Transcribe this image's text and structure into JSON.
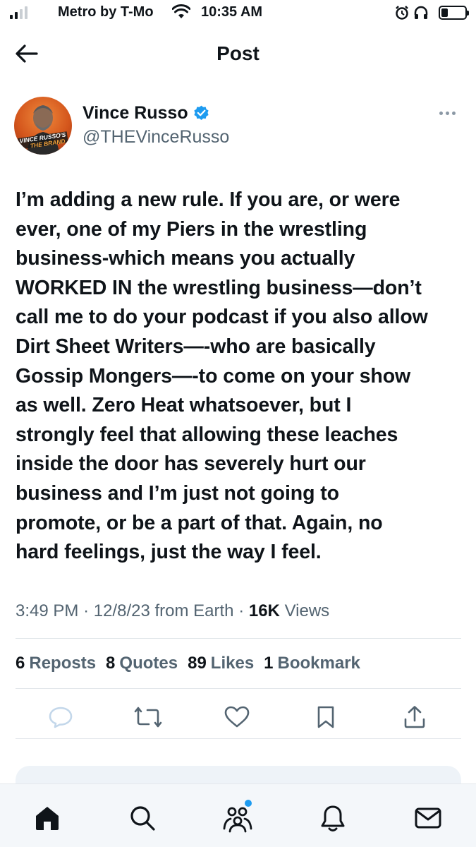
{
  "status_bar": {
    "carrier": "Metro by T-Mo",
    "time": "10:35 AM",
    "battery_level": 0.28,
    "signal_bars": 2,
    "icons": [
      "signal-icon",
      "wifi-icon",
      "alarm-icon",
      "headphones-icon",
      "battery-icon"
    ]
  },
  "header": {
    "title": "Post",
    "back_icon": "arrow-left-icon"
  },
  "author": {
    "name": "Vince Russo",
    "handle": "@THEVinceRusso",
    "verified": true,
    "avatar_caption": "VINCE RUSSO'S THE BRAND",
    "accent_color": "#1d9bf0"
  },
  "tweet": {
    "lines": [
      "I’m adding a new rule. If you are, or were",
      "ever, one of my Piers in the wrestling",
      "business-which means you actually",
      "WORKED IN the wrestling business—don’t",
      "call me to do your podcast if you also allow",
      "Dirt Sheet Writers—-who are basically",
      "Gossip Mongers—-to come on your show",
      "as well. Zero Heat whatsoever, but I",
      "strongly feel that allowing these  leaches",
      "inside the door has severely hurt our",
      "business and I’m just not going to",
      "promote, or be a part of that. Again, no",
      "hard feelings,  just the way I feel."
    ]
  },
  "meta": {
    "time": "3:49 PM",
    "separator": "·",
    "date": "12/8/23",
    "source": "from Earth",
    "views_count": "16K",
    "views_label": "Views"
  },
  "stats": [
    {
      "count": "6",
      "label": "Reposts"
    },
    {
      "count": "8",
      "label": "Quotes"
    },
    {
      "count": "89",
      "label": "Likes"
    },
    {
      "count": "1",
      "label": "Bookmark"
    }
  ],
  "actions": [
    "reply-icon",
    "repost-icon",
    "like-icon",
    "bookmark-icon",
    "share-icon"
  ],
  "tabs": [
    "home-icon",
    "search-icon",
    "communities-icon",
    "notifications-icon",
    "messages-icon"
  ]
}
